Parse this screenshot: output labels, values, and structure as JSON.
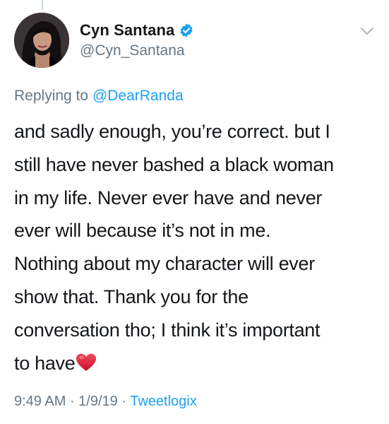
{
  "author": {
    "display_name": "Cyn Santana",
    "handle": "@Cyn_Santana",
    "verified": true
  },
  "reply": {
    "prefix": "Replying to",
    "to_user": "@DearRanda"
  },
  "tweet": {
    "lines": [
      "and sadly enough, you’re correct. but I",
      "still have never bashed a black woman",
      "in my life. Never ever have and never",
      "ever will because it’s not in me.",
      "Nothing about my character will ever",
      "show that. Thank you for the",
      "conversation tho; I think it’s important",
      "to have"
    ],
    "trailing_emoji": "heart-emoji"
  },
  "meta": {
    "time": "9:49 AM",
    "separator": " · ",
    "date": "1/9/19",
    "source": "Tweetlogix"
  },
  "colors": {
    "text": "#14171a",
    "secondary": "#657786",
    "link": "#1da1f2",
    "heart": "#e0245e"
  }
}
